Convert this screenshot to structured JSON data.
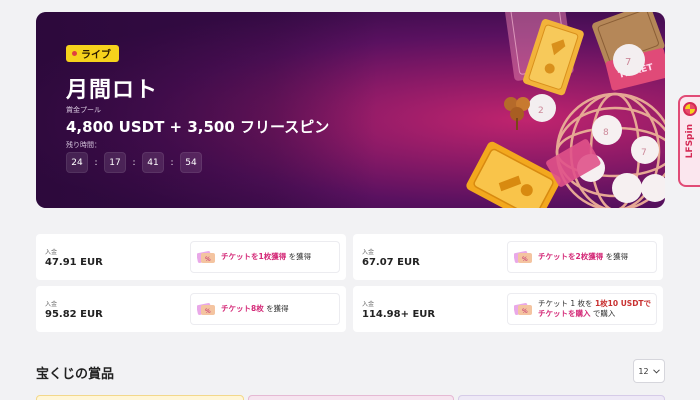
{
  "hero": {
    "badge": "ライブ",
    "title": "月間ロト",
    "pool_label": "賞金プール",
    "pool_value": "4,800 USDT + 3,500 フリースピン",
    "remaining_label": "残り時間：",
    "timer": [
      "24",
      "17",
      "41",
      "54"
    ],
    "timer_sep": ":"
  },
  "side_tab": {
    "label": "LFSpin"
  },
  "deposits": [
    {
      "label": "入金",
      "amount": "47.91 EUR",
      "reward_pre": "",
      "reward_hl": "チケットを1枚獲得",
      "reward_post": " を獲得"
    },
    {
      "label": "入金",
      "amount": "67.07 EUR",
      "reward_pre": "",
      "reward_hl": "チケットを2枚獲得",
      "reward_post": " を獲得"
    },
    {
      "label": "入金",
      "amount": "95.82 EUR",
      "reward_pre": "",
      "reward_hl": "チケット8枚",
      "reward_post": " を獲得"
    },
    {
      "label": "入金",
      "amount": "114.98+ EUR",
      "reward_line1_pre": "チケット 1 枚を ",
      "reward_line1_hl": "1枚10 USDTで",
      "reward_line2_hl": "チケットを購入",
      "reward_line2_post": " で購入"
    }
  ],
  "section": {
    "title": "宝くじの賞品",
    "per_page": "12"
  },
  "colors": {
    "accent": "#d42a78",
    "badge": "#f6d21c",
    "hero_dark": "#3a0c4a",
    "hero_glow": "#c0246e"
  }
}
